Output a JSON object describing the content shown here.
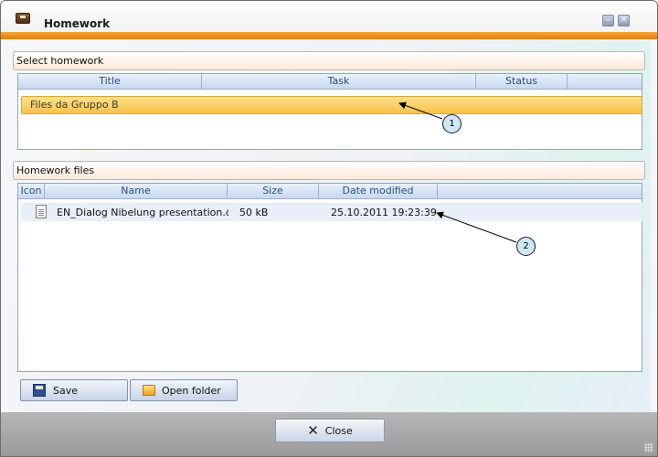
{
  "window": {
    "title": "Homework",
    "minimize_glyph": "–",
    "close_glyph": "✕"
  },
  "select_homework": {
    "header": "Select homework",
    "columns": [
      "Title",
      "Task",
      "Status"
    ],
    "rows": [
      {
        "title": "Files da Gruppo B",
        "selected": true
      }
    ]
  },
  "homework_files": {
    "header": "Homework files",
    "columns": [
      "Icon",
      "Name",
      "Size",
      "Date modified"
    ],
    "rows": [
      {
        "icon": "document-icon",
        "name": "EN_Dialog Nibelung presentation.dc",
        "size": "50 kB",
        "date_modified": "25.10.2011 19:23:39"
      }
    ]
  },
  "buttons": {
    "save_label": "Save",
    "open_folder_label": "Open folder",
    "close_label": "Close"
  },
  "callouts": [
    "1",
    "2"
  ],
  "colors": {
    "accent_orange": "#e47a0c",
    "selection_yellow": "#f8c24a",
    "header_blue": "#2a4f86"
  }
}
